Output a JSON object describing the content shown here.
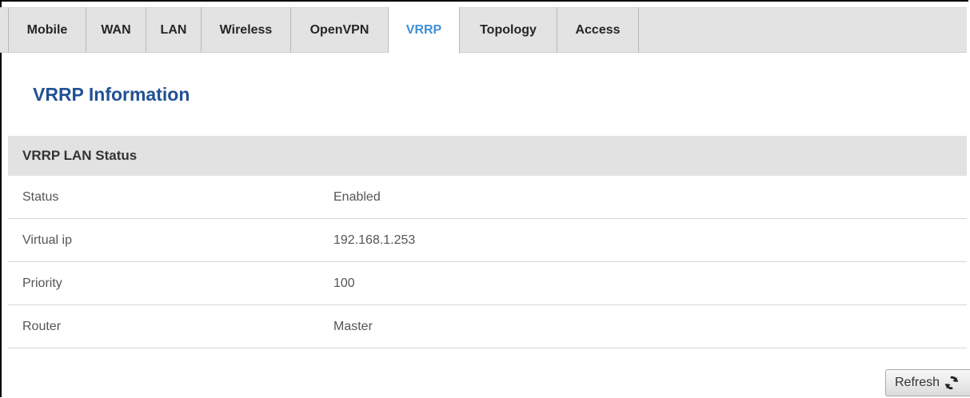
{
  "tabs": [
    {
      "label": "Mobile",
      "active": false
    },
    {
      "label": "WAN",
      "active": false
    },
    {
      "label": "LAN",
      "active": false
    },
    {
      "label": "Wireless",
      "active": false
    },
    {
      "label": "OpenVPN",
      "active": false
    },
    {
      "label": "VRRP",
      "active": true
    },
    {
      "label": "Topology",
      "active": false
    },
    {
      "label": "Access",
      "active": false
    }
  ],
  "page": {
    "title": "VRRP Information"
  },
  "section": {
    "title": "VRRP LAN Status",
    "rows": [
      {
        "label": "Status",
        "value": "Enabled"
      },
      {
        "label": "Virtual ip",
        "value": "192.168.1.253"
      },
      {
        "label": "Priority",
        "value": "100"
      },
      {
        "label": "Router",
        "value": "Master"
      }
    ]
  },
  "actions": {
    "refresh_label": "Refresh",
    "refresh_icon": "refresh-icon"
  },
  "colors": {
    "active_tab": "#3f8fd7",
    "title": "#225193",
    "section_header_bg": "#e2e2e2",
    "tabbar_bg": "#e3e3e3"
  }
}
